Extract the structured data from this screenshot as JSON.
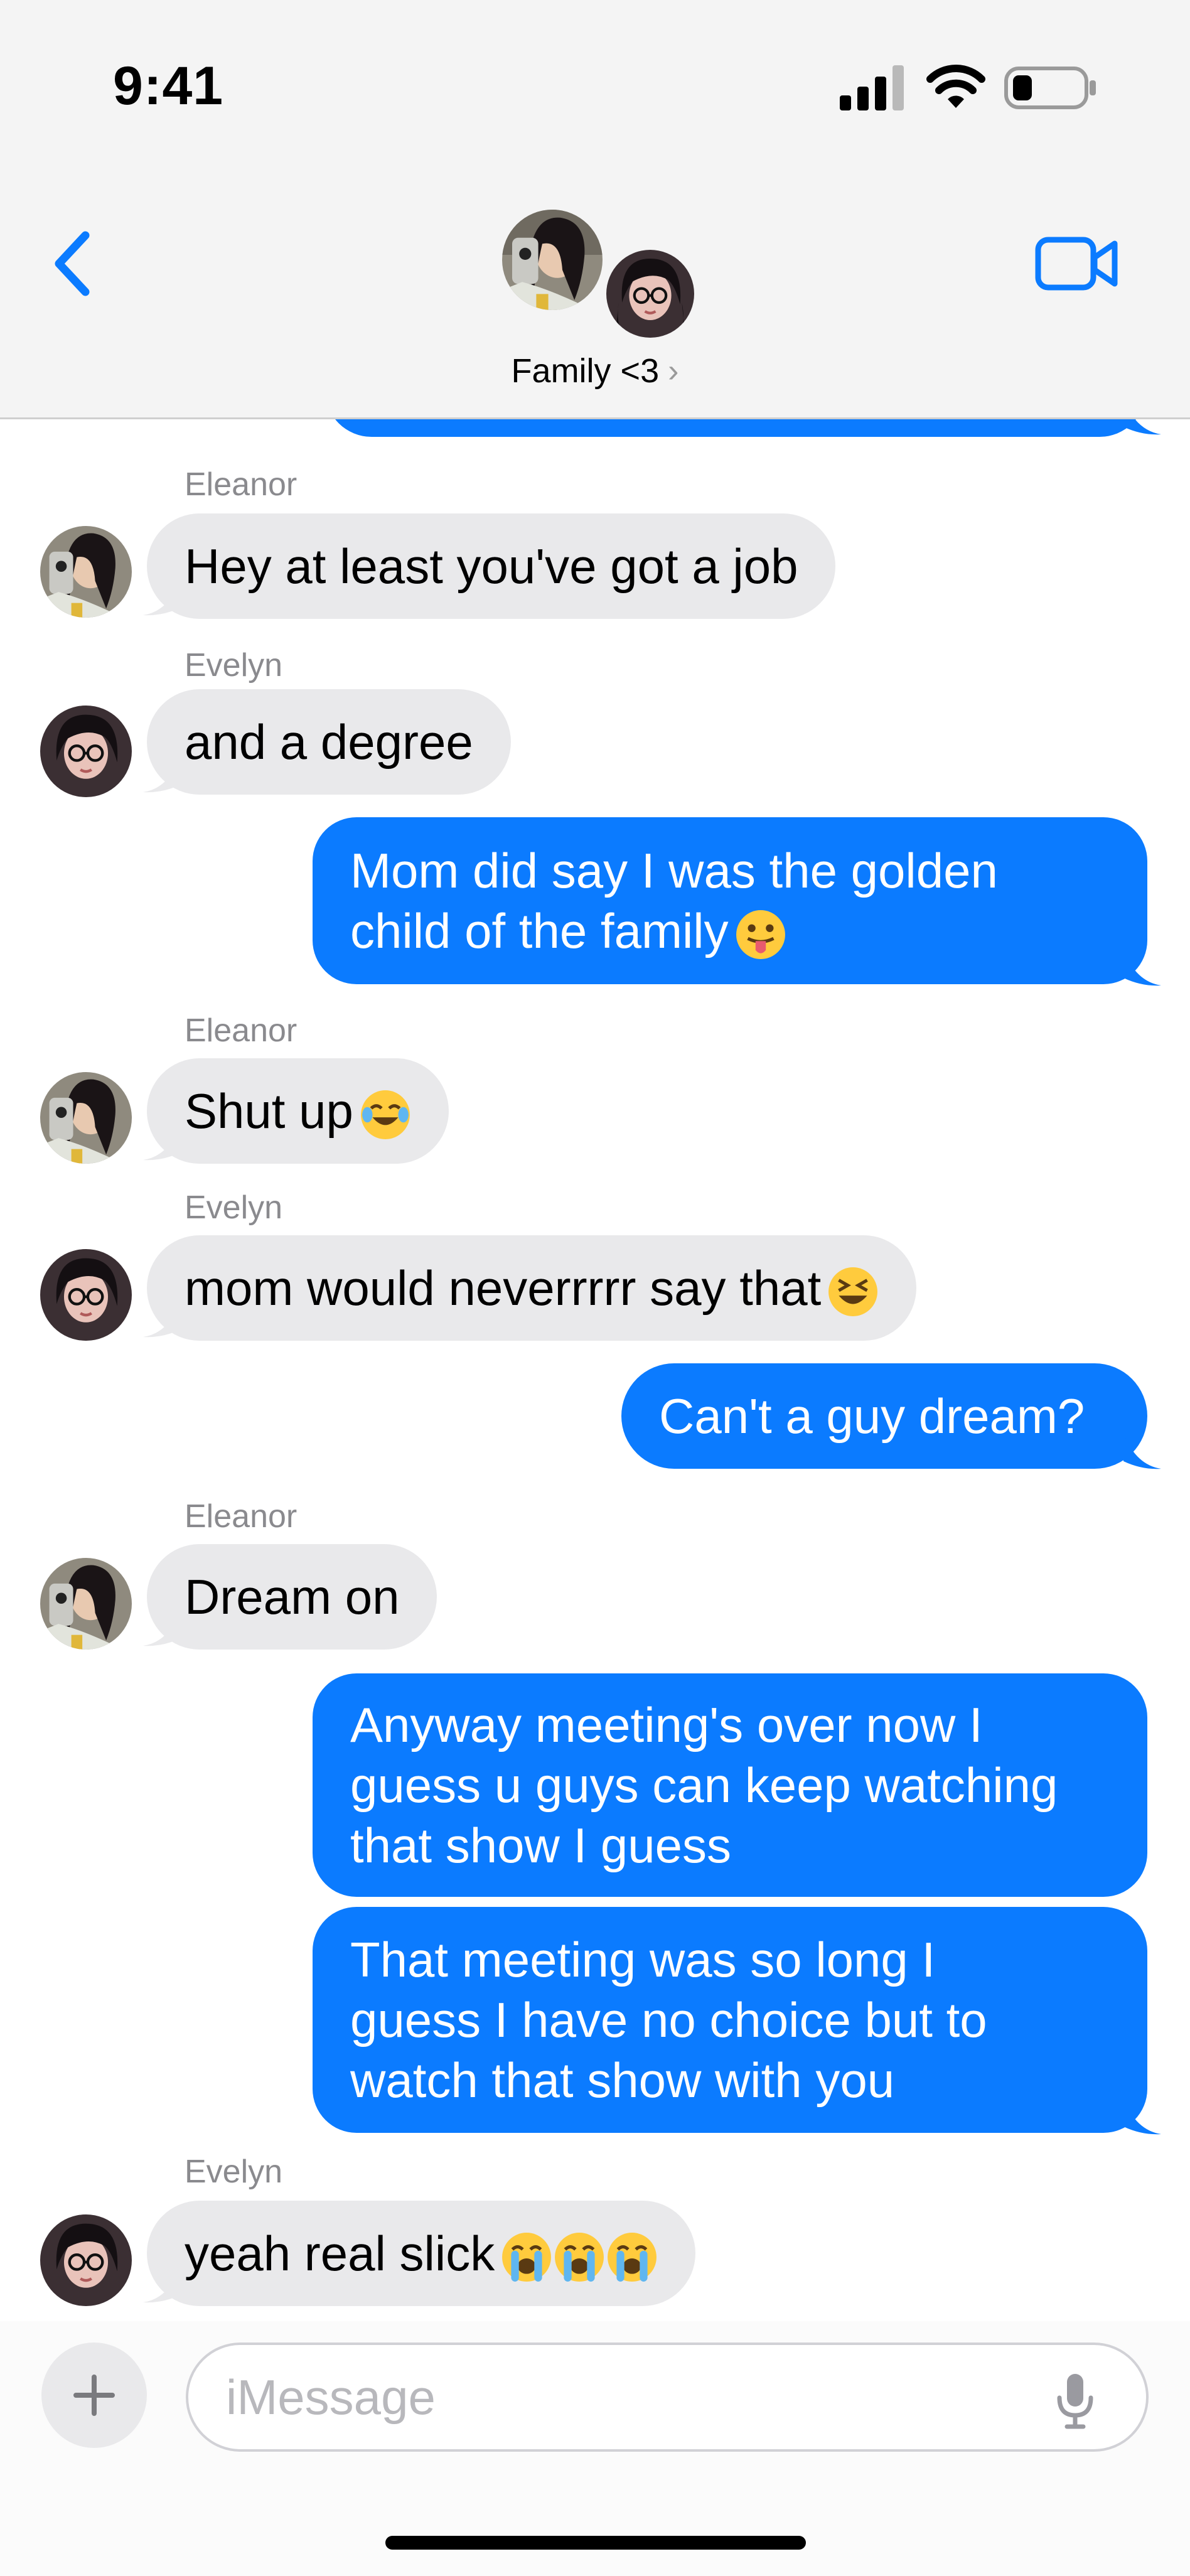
{
  "status_bar": {
    "time": "9:41",
    "icons": [
      "cellular-signal-icon",
      "wifi-icon",
      "battery-icon"
    ]
  },
  "header": {
    "group_name": "Family <3",
    "back_icon": "chevron-left-icon",
    "video_icon": "video-camera-icon",
    "accent_color": "#0b7bff"
  },
  "messages": [
    {
      "id": "m1",
      "sender": "Eleanor",
      "direction": "incoming",
      "text": "Hey at least you've got a job"
    },
    {
      "id": "m2",
      "sender": "Evelyn",
      "direction": "incoming",
      "text": "and a degree"
    },
    {
      "id": "m3",
      "direction": "outgoing",
      "text": "Mom did say I was the golden\nchild of the family",
      "emoji": [
        "face-with-tongue-emoji"
      ]
    },
    {
      "id": "m4",
      "sender": "Eleanor",
      "direction": "incoming",
      "text": "Shut up",
      "emoji": [
        "face-with-tears-of-joy-emoji"
      ]
    },
    {
      "id": "m5",
      "sender": "Evelyn",
      "direction": "incoming",
      "text": "mom would neverrrrr say that",
      "emoji": [
        "grinning-squinting-face-emoji"
      ]
    },
    {
      "id": "m6",
      "direction": "outgoing",
      "text": "Can't a guy dream?"
    },
    {
      "id": "m7",
      "sender": "Eleanor",
      "direction": "incoming",
      "text": "Dream on"
    },
    {
      "id": "m8",
      "direction": "outgoing",
      "text": "Anyway meeting's over now I\nguess u guys can keep watching\nthat show I guess"
    },
    {
      "id": "m9",
      "direction": "outgoing",
      "text": "That meeting was so long I\nguess I have no choice but to\nwatch that show with you"
    },
    {
      "id": "m10",
      "sender": "Evelyn",
      "direction": "incoming",
      "text": "yeah real slick",
      "emoji": [
        "loudly-crying-face-emoji",
        "loudly-crying-face-emoji",
        "loudly-crying-face-emoji"
      ]
    }
  ],
  "composer": {
    "placeholder": "iMessage",
    "value": "",
    "plus_icon": "plus-icon",
    "mic_icon": "microphone-icon"
  },
  "colors": {
    "outgoing_bubble": "#0b7bff",
    "incoming_bubble": "#e9e9eb",
    "sender_label": "#8a8a8e",
    "header_bg": "#f4f4f4"
  }
}
